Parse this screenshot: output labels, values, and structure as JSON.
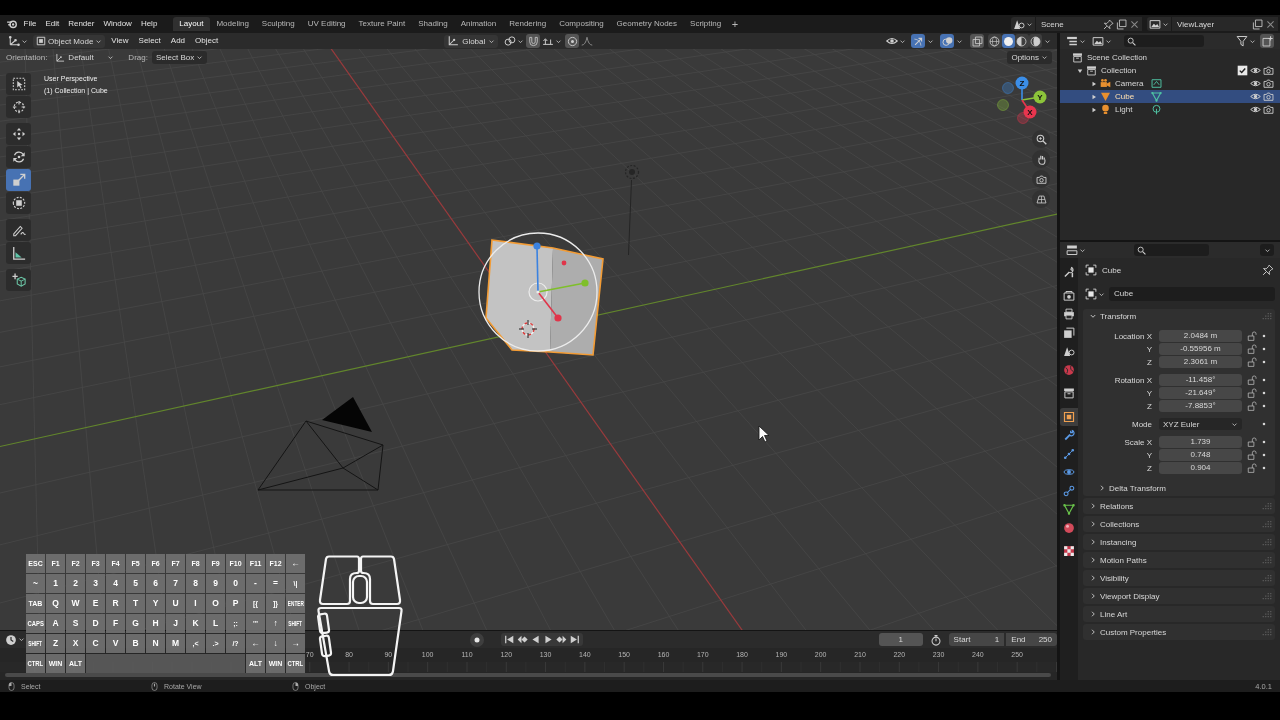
{
  "top_bar": {
    "menus": [
      "File",
      "Edit",
      "Render",
      "Window",
      "Help"
    ],
    "workspaces": [
      {
        "label": "Layout",
        "selected": true
      },
      {
        "label": "Modeling",
        "selected": false
      },
      {
        "label": "Sculpting",
        "selected": false
      },
      {
        "label": "UV Editing",
        "selected": false
      },
      {
        "label": "Texture Paint",
        "selected": false
      },
      {
        "label": "Shading",
        "selected": false
      },
      {
        "label": "Animation",
        "selected": false
      },
      {
        "label": "Rendering",
        "selected": false
      },
      {
        "label": "Compositing",
        "selected": false
      },
      {
        "label": "Geometry Nodes",
        "selected": false
      },
      {
        "label": "Scripting",
        "selected": false
      }
    ],
    "add_workspace": "+",
    "scene": "Scene",
    "view_layer": "ViewLayer"
  },
  "viewport": {
    "header": {
      "mode": "Object Mode",
      "menus": [
        "View",
        "Select",
        "Add",
        "Object"
      ],
      "orientation": "Global",
      "gizmos_on": true,
      "overlays_on": true,
      "xray_on": false,
      "shading": [
        {
          "kind": "wireframe",
          "selected": false
        },
        {
          "kind": "solid",
          "selected": true
        },
        {
          "kind": "material",
          "selected": false
        },
        {
          "kind": "rendered",
          "selected": false
        }
      ]
    },
    "tool_settings": {
      "orientation_label": "Orientation:",
      "orientation": "Default",
      "drag_label": "Drag:",
      "drag": "Select Box",
      "options": "Options"
    },
    "info": [
      "User Perspective",
      "(1) Collection | Cube"
    ],
    "tools": [
      [
        {
          "kind": "select",
          "selected": false
        },
        {
          "kind": "cursor",
          "selected": false
        }
      ],
      [
        {
          "kind": "move",
          "selected": false
        },
        {
          "kind": "rotate",
          "selected": false
        },
        {
          "kind": "scale",
          "selected": true
        },
        {
          "kind": "transform",
          "selected": false
        }
      ],
      [
        {
          "kind": "annotate",
          "selected": false
        },
        {
          "kind": "measure",
          "selected": false
        }
      ],
      [
        {
          "kind": "addcube",
          "selected": false
        }
      ]
    ],
    "axes": [
      {
        "label": "Z",
        "color": "#3b8ee8"
      },
      {
        "label": "Y",
        "color": "#8cc43a"
      },
      {
        "label": "X",
        "color": "#e8354e"
      }
    ]
  },
  "timeline": {
    "auto_keying": false,
    "current_frame": "1",
    "start_label": "Start",
    "start": "1",
    "end_label": "End",
    "end": "250",
    "ruler": [
      "70",
      "80",
      "90",
      "100",
      "110",
      "120",
      "130",
      "140",
      "150",
      "160",
      "170",
      "180",
      "190",
      "200",
      "210",
      "220",
      "230",
      "240",
      "250"
    ]
  },
  "keyboard": {
    "rows": [
      [
        "ESC",
        "F1",
        "F2",
        "F3",
        "F4",
        "F5",
        "F6",
        "F7",
        "F8",
        "F9",
        "F10",
        "F11",
        "F12",
        "←"
      ],
      [
        "~",
        "1",
        "2",
        "3",
        "4",
        "5",
        "6",
        "7",
        "8",
        "9",
        "0",
        "-",
        "=",
        "\\|"
      ],
      [
        "TAB",
        "Q",
        "W",
        "E",
        "R",
        "T",
        "Y",
        "U",
        "I",
        "O",
        "P",
        "[{",
        "]}",
        "ENTER"
      ],
      [
        "CAPS",
        "A",
        "S",
        "D",
        "F",
        "G",
        "H",
        "J",
        "K",
        "L",
        ";:",
        "'\"",
        "↑",
        "SHIFT"
      ],
      [
        "SHIFT",
        "Z",
        "X",
        "C",
        "V",
        "B",
        "N",
        "M",
        ",<",
        ".>",
        "/?",
        "←",
        "↓",
        "→"
      ]
    ],
    "bottom_left": [
      "CTRL",
      "WIN",
      "ALT"
    ],
    "bottom_right": [
      "ALT",
      "WIN",
      "CTRL"
    ]
  },
  "outliner": {
    "tree": [
      {
        "label": "Scene Collection",
        "kind": "scene",
        "selected": false,
        "children": [
          {
            "label": "Collection",
            "kind": "collection",
            "selected": false,
            "expanded": true,
            "checked": true,
            "children": [
              {
                "label": "Camera",
                "kind": "camera",
                "selected": false,
                "expanded": false
              },
              {
                "label": "Cube",
                "kind": "mesh",
                "selected": true,
                "expanded": false
              },
              {
                "label": "Light",
                "kind": "light",
                "selected": false,
                "expanded": false
              }
            ]
          }
        ]
      }
    ]
  },
  "properties": {
    "tabs": [
      [
        {
          "kind": "tool",
          "selected": false
        }
      ],
      [
        {
          "kind": "render",
          "selected": false
        },
        {
          "kind": "output",
          "selected": false
        },
        {
          "kind": "viewlayer",
          "selected": false
        },
        {
          "kind": "scene",
          "selected": false
        },
        {
          "kind": "world",
          "selected": false
        }
      ],
      [
        {
          "kind": "collection",
          "selected": false
        }
      ],
      [
        {
          "kind": "object",
          "selected": true
        },
        {
          "kind": "modifiers",
          "selected": false
        },
        {
          "kind": "particles",
          "selected": false
        },
        {
          "kind": "physics",
          "selected": false
        },
        {
          "kind": "constraints",
          "selected": false
        },
        {
          "kind": "data",
          "selected": false
        },
        {
          "kind": "material",
          "selected": false
        }
      ],
      [
        {
          "kind": "texture",
          "selected": false
        }
      ]
    ],
    "context": "Cube",
    "name": "Cube",
    "transform": {
      "title": "Transform",
      "expanded": true,
      "groups": [
        [
          {
            "kind": "number",
            "label": "Location X",
            "value": "2.0484 m"
          },
          {
            "kind": "number",
            "label": "Y",
            "value": "-0.55956 m"
          },
          {
            "kind": "number",
            "label": "Z",
            "value": "2.3061 m"
          }
        ],
        [
          {
            "kind": "number",
            "label": "Rotation X",
            "value": "-11.458°"
          },
          {
            "kind": "number",
            "label": "Y",
            "value": "-21.649°"
          },
          {
            "kind": "number",
            "label": "Z",
            "value": "-7.8853°"
          }
        ],
        [
          {
            "kind": "dropdown",
            "label": "Mode",
            "value": "XYZ Euler"
          }
        ],
        [
          {
            "kind": "number",
            "label": "Scale X",
            "value": "1.739"
          },
          {
            "kind": "number",
            "label": "Y",
            "value": "0.748"
          },
          {
            "kind": "number",
            "label": "Z",
            "value": "0.904"
          }
        ]
      ],
      "subpanel": {
        "title": "Delta Transform",
        "expanded": false
      }
    },
    "panels": [
      {
        "title": "Relations",
        "expanded": false
      },
      {
        "title": "Collections",
        "expanded": false
      },
      {
        "title": "Instancing",
        "expanded": false
      },
      {
        "title": "Motion Paths",
        "expanded": false
      },
      {
        "title": "Visibility",
        "expanded": false
      },
      {
        "title": "Viewport Display",
        "expanded": false
      },
      {
        "title": "Line Art",
        "expanded": false
      },
      {
        "title": "Custom Properties",
        "expanded": false
      }
    ]
  },
  "status_bar": {
    "hints": [
      {
        "kind": "left",
        "label": "Select"
      },
      {
        "kind": "middle",
        "label": "Rotate View"
      },
      {
        "kind": "right",
        "label": "Object"
      }
    ],
    "version": "4.0.1"
  }
}
